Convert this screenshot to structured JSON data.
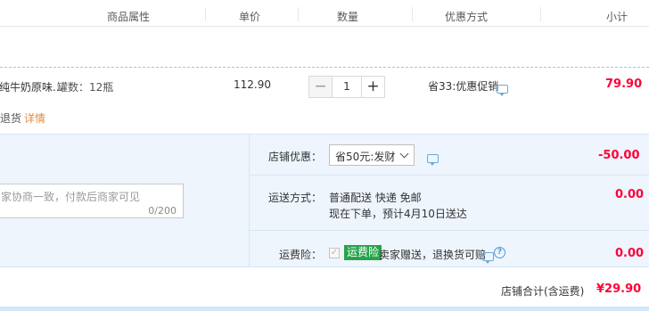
{
  "header": {
    "col_attrs": "商品属性",
    "col_price": "单价",
    "col_qty": "数量",
    "col_discount": "优惠方式",
    "col_subtotal": "小计"
  },
  "item": {
    "title_fragment": "纯牛奶原味...",
    "spec": "罐数：12瓶",
    "price": "112.90",
    "quantity": "1",
    "qty_minus_symbol": "−",
    "qty_plus_symbol": "+",
    "discount": "省33:优惠促销",
    "subtotal": "79.90",
    "return_text": "退货",
    "detail_link": "详情"
  },
  "shop_discount": {
    "label": "店铺优惠：",
    "selected": "省50元:发财",
    "amount": "-50.00"
  },
  "message": {
    "placeholder": "家协商一致，付款后商家可见",
    "counter": "0/200"
  },
  "shipping": {
    "label": "运送方式：",
    "line1": "普通配送 快递 免邮",
    "line2": "现在下单，预计4月10日送达",
    "amount": "0.00"
  },
  "insurance": {
    "label": "运费险：",
    "check_mark": "✓",
    "badge": "运费险",
    "desc": "卖家赠送，退换货可赔",
    "q_mark": "?",
    "amount": "0.00"
  },
  "total": {
    "label": "店铺合计(含运费)",
    "amount": "¥29.90"
  },
  "colors": {
    "price_red": "#ff0036",
    "badge_green": "#27a34a",
    "panel_blue": "#eef5fd",
    "link_orange": "#e08a3c"
  }
}
